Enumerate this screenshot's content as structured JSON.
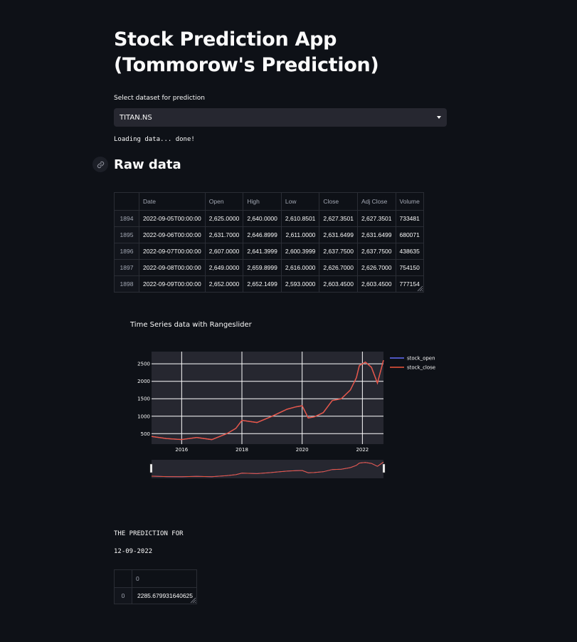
{
  "header": {
    "title": "Stock Prediction App (Tommorow's Prediction)"
  },
  "dataset_select": {
    "label": "Select dataset for prediction",
    "value": "TITAN.NS"
  },
  "loading_text": "Loading data... done!",
  "raw_data": {
    "heading": "Raw data",
    "columns": [
      "",
      "Date",
      "Open",
      "High",
      "Low",
      "Close",
      "Adj Close",
      "Volume"
    ],
    "rows": [
      [
        "1894",
        "2022-09-05T00:00:00",
        "2,625.0000",
        "2,640.0000",
        "2,610.8501",
        "2,627.3501",
        "2,627.3501",
        "733481"
      ],
      [
        "1895",
        "2022-09-06T00:00:00",
        "2,631.7000",
        "2,646.8999",
        "2,611.0000",
        "2,631.6499",
        "2,631.6499",
        "680071"
      ],
      [
        "1896",
        "2022-09-07T00:00:00",
        "2,607.0000",
        "2,641.3999",
        "2,600.3999",
        "2,637.7500",
        "2,637.7500",
        "438635"
      ],
      [
        "1897",
        "2022-09-08T00:00:00",
        "2,649.0000",
        "2,659.8999",
        "2,616.0000",
        "2,626.7000",
        "2,626.7000",
        "754150"
      ],
      [
        "1898",
        "2022-09-09T00:00:00",
        "2,652.0000",
        "2,652.1499",
        "2,593.0000",
        "2,603.4500",
        "2,603.4500",
        "777154"
      ]
    ]
  },
  "chart_data": {
    "type": "line",
    "title": "Time Series data with Rangeslider",
    "xlabel": "",
    "ylabel": "",
    "x_range": [
      2015.0,
      2022.7
    ],
    "ylim": [
      200,
      2850
    ],
    "x_ticks": [
      "2016",
      "2018",
      "2020",
      "2022"
    ],
    "x_tick_values": [
      2016,
      2018,
      2020,
      2022
    ],
    "y_ticks": [
      "500",
      "1000",
      "1500",
      "2000",
      "2500"
    ],
    "y_tick_values": [
      500,
      1000,
      1500,
      2000,
      2500
    ],
    "grid": true,
    "legend_position": "top-right",
    "rangeslider": true,
    "series": [
      {
        "name": "stock_open",
        "color": "#636efa",
        "x": [
          2015.0,
          2015.5,
          2016.0,
          2016.5,
          2017.0,
          2017.5,
          2017.8,
          2018.0,
          2018.5,
          2019.0,
          2019.5,
          2019.8,
          2020.0,
          2020.2,
          2020.4,
          2020.7,
          2021.0,
          2021.3,
          2021.6,
          2021.8,
          2021.9,
          2022.1,
          2022.3,
          2022.5,
          2022.7
        ],
        "y": [
          420,
          360,
          330,
          390,
          330,
          500,
          650,
          880,
          820,
          1000,
          1200,
          1270,
          1300,
          950,
          980,
          1100,
          1450,
          1500,
          1750,
          2100,
          2450,
          2550,
          2400,
          1950,
          2600
        ]
      },
      {
        "name": "stock_close",
        "color": "#ef553b",
        "x": [
          2015.0,
          2015.5,
          2016.0,
          2016.5,
          2017.0,
          2017.5,
          2017.8,
          2018.0,
          2018.5,
          2019.0,
          2019.5,
          2019.8,
          2020.0,
          2020.2,
          2020.4,
          2020.7,
          2021.0,
          2021.3,
          2021.6,
          2021.8,
          2021.9,
          2022.1,
          2022.3,
          2022.5,
          2022.7
        ],
        "y": [
          420,
          360,
          330,
          390,
          330,
          500,
          650,
          880,
          820,
          1000,
          1200,
          1270,
          1300,
          950,
          980,
          1100,
          1450,
          1500,
          1750,
          2100,
          2450,
          2550,
          2400,
          1950,
          2603
        ]
      }
    ]
  },
  "prediction": {
    "label": "THE PREDICTION FOR",
    "date": "12-09-2022",
    "columns": [
      "",
      "0"
    ],
    "rows": [
      [
        "0",
        "2285.679931640625"
      ]
    ]
  }
}
